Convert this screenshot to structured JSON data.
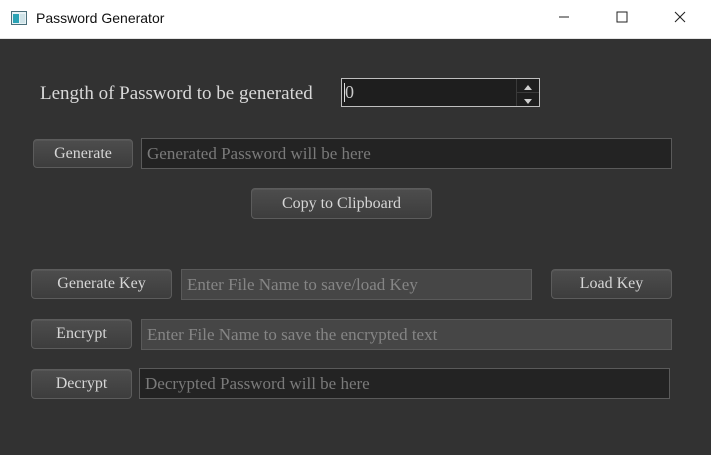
{
  "window": {
    "title": "Password Generator",
    "icon": "app-window-icon"
  },
  "length": {
    "label": "Length of Password to be generated",
    "value": "0"
  },
  "generate": {
    "button_label": "Generate",
    "output_placeholder": "Generated Password will be here"
  },
  "copy": {
    "button_label": "Copy to Clipboard"
  },
  "key": {
    "generate_label": "Generate Key",
    "file_placeholder": "Enter File Name to save/load Key",
    "load_label": "Load Key"
  },
  "encrypt": {
    "button_label": "Encrypt",
    "file_placeholder": "Enter File Name to save the encrypted text"
  },
  "decrypt": {
    "button_label": "Decrypt",
    "output_placeholder": "Decrypted Password will be here"
  },
  "colors": {
    "background": "#323232",
    "field_dark": "#232323",
    "field_light": "#464646",
    "text": "#d8d8d8"
  }
}
